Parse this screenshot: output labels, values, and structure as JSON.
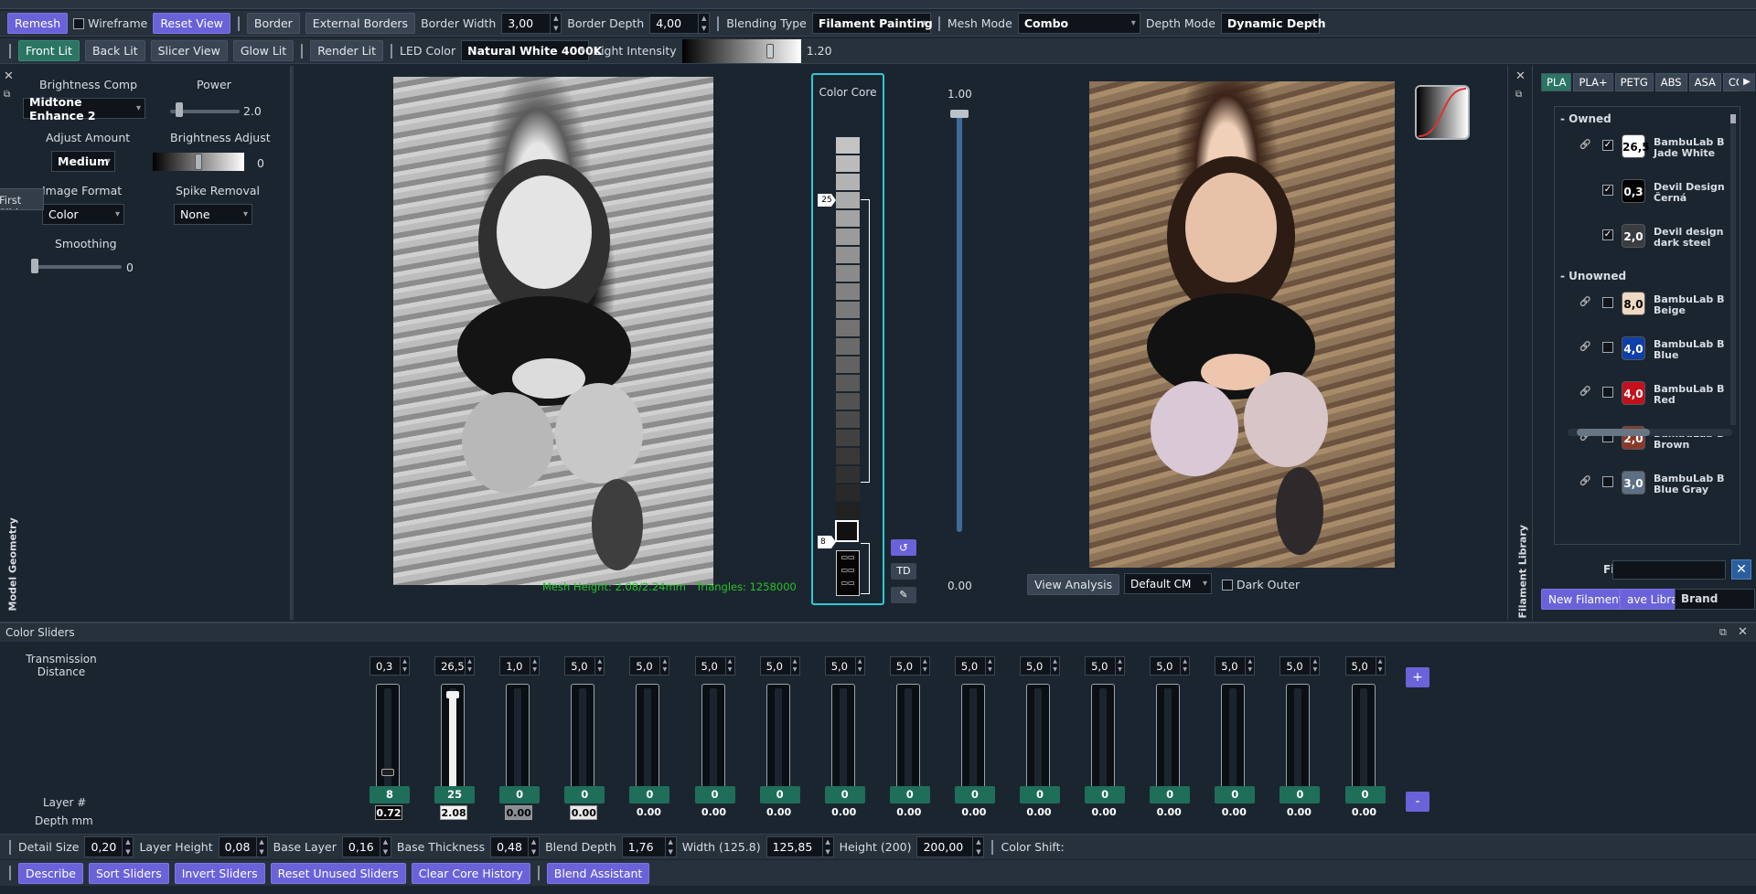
{
  "toolbar1": {
    "remesh": "Remesh",
    "wireframe": "Wireframe",
    "reset_view": "Reset View",
    "border": "Border",
    "external_borders": "External Borders",
    "border_width_label": "Border Width",
    "border_width": "3,00",
    "border_depth_label": "Border Depth",
    "border_depth": "4,00",
    "blending_label": "Blending Type",
    "blending": "Filament Painting",
    "mesh_mode_label": "Mesh Mode",
    "mesh_mode": "Combo",
    "depth_mode_label": "Depth Mode",
    "depth_mode": "Dynamic Depth"
  },
  "toolbar2": {
    "front_lit": "Front Lit",
    "back_lit": "Back Lit",
    "slicer_view": "Slicer View",
    "glow_lit": "Glow Lit",
    "render_lit": "Render Lit",
    "led_label": "LED Color",
    "led_color": "Natural White 4000K",
    "intensity_label": "Light Intensity",
    "intensity": "1.20",
    "intensity_level": 0.75
  },
  "left": {
    "brightness_comp": "Brightness Comp",
    "brightness_comp_value": "Midtone Enhance 2",
    "power": "Power",
    "power_value": "2.0",
    "adjust_amount": "Adjust Amount",
    "adjust_value": "Medium",
    "brightness_adjust": "Brightness Adjust",
    "brightness_adjust_value": "0",
    "image_format": "Image Format",
    "image_format_value": "Color",
    "spike_removal": "Spike Removal",
    "spike_value": "None",
    "smoothing": "Smoothing",
    "smoothing_value": "0",
    "tooltip": "First Slider",
    "vertical_label": "Model Geometry"
  },
  "viewport": {
    "mesh_info": "Mesh Height: 2.08/2.24mm   Triangles: 1258000",
    "color_core": "Color Core",
    "core_top_marker": "25",
    "core_bottom_marker": "8",
    "td_button": "TD",
    "scale_top": "1.00",
    "scale_bottom": "0.00",
    "view_analysis": "View Analysis",
    "cm_value": "Default CM",
    "dark_outer": "Dark Outer"
  },
  "library": {
    "vertical_label": "Filament Library",
    "tabs": [
      "PLA",
      "PLA+",
      "PETG",
      "ABS",
      "ASA",
      "CO"
    ],
    "owned_header": "- Owned",
    "unowned_header": "- Unowned",
    "owned": [
      {
        "td": "26,5",
        "name1": "BambuLab B",
        "name2": "Jade White",
        "bg": "#ffffff",
        "fg": "#000000",
        "checked": true
      },
      {
        "td": "0,3",
        "name1": "Devil Design",
        "name2": "Černá",
        "bg": "#000000",
        "fg": "#ffffff",
        "checked": true
      },
      {
        "td": "2,0",
        "name1": "Devil design",
        "name2": "dark steel",
        "bg": "#3a3d42",
        "fg": "#ffffff",
        "checked": true
      }
    ],
    "unowned": [
      {
        "td": "8,0",
        "name1": "BambuLab B",
        "name2": "Beige",
        "bg": "#f0d9c2",
        "fg": "#000000"
      },
      {
        "td": "4,0",
        "name1": "BambuLab B",
        "name2": "Blue",
        "bg": "#0f3fa8",
        "fg": "#ffffff"
      },
      {
        "td": "4,0",
        "name1": "BambuLab B",
        "name2": "Red",
        "bg": "#c4101c",
        "fg": "#ffffff"
      },
      {
        "td": "2,0",
        "name1": "BambuLab B",
        "name2": "Brown",
        "bg": "#8a3a2a",
        "fg": "#ffffff"
      },
      {
        "td": "3,0",
        "name1": "BambuLab B",
        "name2": "Blue Gray",
        "bg": "#5d6f84",
        "fg": "#ffffff"
      }
    ],
    "filter_label": "Filter",
    "new_filament": "New Filament",
    "save_library": "ave Library",
    "brand": "Brand"
  },
  "sliders": {
    "title": "Color Sliders",
    "transmission_label": "Transmission\nDistance",
    "layer_label": "Layer #",
    "depth_label": "Depth mm",
    "items": [
      {
        "td": "0,3",
        "layer": "8",
        "depth": "0.72",
        "fill": 0.19,
        "style": "white"
      },
      {
        "td": "26,5",
        "layer": "25",
        "depth": "2.08",
        "fill": 0.92,
        "style": "white"
      },
      {
        "td": "1,0",
        "layer": "0",
        "depth": "0.00",
        "fill": 0.0,
        "style": "gray"
      },
      {
        "td": "5,0",
        "layer": "0",
        "depth": "0.00",
        "fill": 0.0,
        "style": "light"
      },
      {
        "td": "5,0",
        "layer": "0",
        "depth": "0.00",
        "fill": 0.0,
        "style": "plain"
      },
      {
        "td": "5,0",
        "layer": "0",
        "depth": "0.00",
        "fill": 0.0,
        "style": "plain"
      },
      {
        "td": "5,0",
        "layer": "0",
        "depth": "0.00",
        "fill": 0.0,
        "style": "plain"
      },
      {
        "td": "5,0",
        "layer": "0",
        "depth": "0.00",
        "fill": 0.0,
        "style": "plain"
      },
      {
        "td": "5,0",
        "layer": "0",
        "depth": "0.00",
        "fill": 0.0,
        "style": "plain"
      },
      {
        "td": "5,0",
        "layer": "0",
        "depth": "0.00",
        "fill": 0.0,
        "style": "plain"
      },
      {
        "td": "5,0",
        "layer": "0",
        "depth": "0.00",
        "fill": 0.0,
        "style": "plain"
      },
      {
        "td": "5,0",
        "layer": "0",
        "depth": "0.00",
        "fill": 0.0,
        "style": "plain"
      },
      {
        "td": "5,0",
        "layer": "0",
        "depth": "0.00",
        "fill": 0.0,
        "style": "plain"
      },
      {
        "td": "5,0",
        "layer": "0",
        "depth": "0.00",
        "fill": 0.0,
        "style": "plain"
      },
      {
        "td": "5,0",
        "layer": "0",
        "depth": "0.00",
        "fill": 0.0,
        "style": "plain"
      },
      {
        "td": "5,0",
        "layer": "0",
        "depth": "0.00",
        "fill": 0.0,
        "style": "plain"
      }
    ],
    "plus": "+",
    "minus": "-"
  },
  "bottom1": {
    "detail_label": "Detail Size",
    "detail": "0,20",
    "layer_h_label": "Layer Height",
    "layer_h": "0,08",
    "base_layer_label": "Base Layer",
    "base_layer": "0,16",
    "base_thick_label": "Base Thickness",
    "base_thick": "0,48",
    "blend_label": "Blend Depth",
    "blend": "1,76",
    "width_label": "Width (125.8)",
    "width": "125,85",
    "height_label": "Height (200)",
    "height": "200,00",
    "shift_label": "Color Shift:"
  },
  "bottom2": {
    "describe": "Describe",
    "sort": "Sort Sliders",
    "invert": "Invert Sliders",
    "reset_unused": "Reset Unused Sliders",
    "clear_core": "Clear Core History",
    "blend_assistant": "Blend Assistant"
  }
}
